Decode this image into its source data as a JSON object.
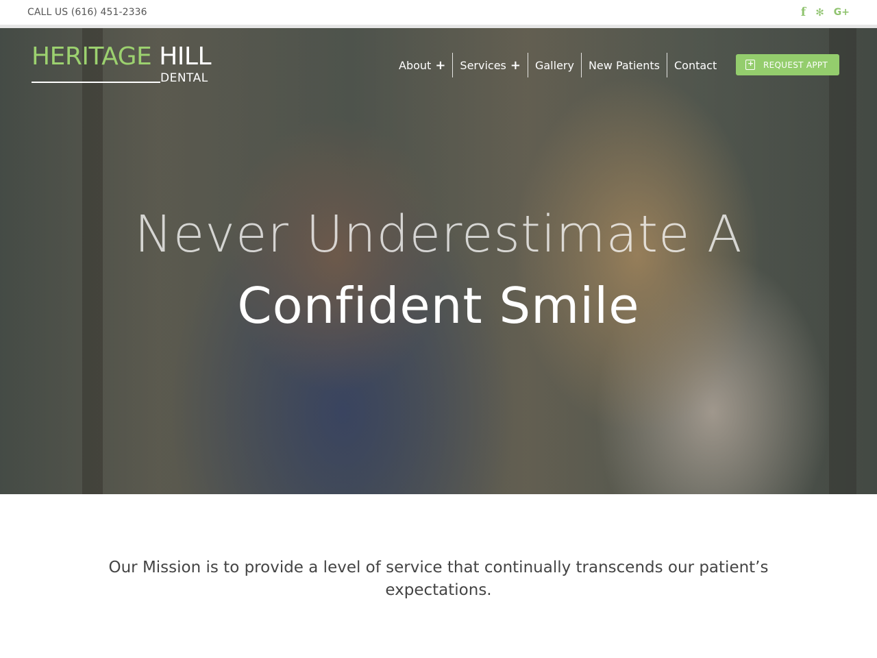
{
  "topbar": {
    "call_text": "CALL US (616) 451-2336",
    "social": [
      {
        "icon": "facebook-icon",
        "glyph": "f"
      },
      {
        "icon": "yelp-icon",
        "glyph": "✻"
      },
      {
        "icon": "google-plus-icon",
        "glyph": "G+"
      }
    ]
  },
  "logo": {
    "word1": "HERITAGE",
    "word2": "HILL",
    "word3": "DENTAL"
  },
  "nav": {
    "items": [
      {
        "label": "About",
        "has_submenu": true,
        "indicator": "+"
      },
      {
        "label": "Services",
        "has_submenu": true,
        "indicator": "+"
      },
      {
        "label": "Gallery"
      },
      {
        "label": "New Patients"
      },
      {
        "label": "Contact"
      }
    ]
  },
  "cta": {
    "label": "REQUEST APPT",
    "icon": "calendar-plus-icon"
  },
  "hero": {
    "line1": "Never Underestimate A",
    "line2": "Confident Smile"
  },
  "mission": {
    "text": "Our Mission is to provide a level of service that continually transcends our patient’s expectations."
  },
  "colors": {
    "accent_green": "#94cd6d",
    "logo_green": "#9cd16f",
    "text_gray": "#444444"
  }
}
